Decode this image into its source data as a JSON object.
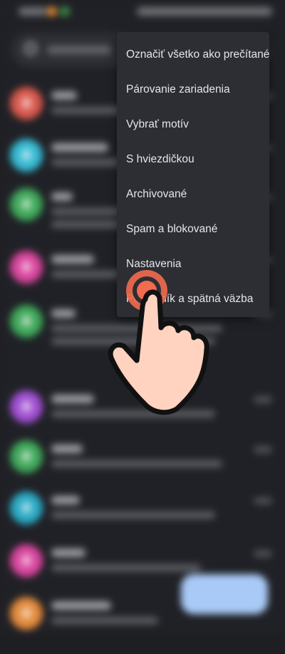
{
  "menu": {
    "items": [
      {
        "label": "Označiť všetko ako prečítané"
      },
      {
        "label": "Párovanie zariadenia"
      },
      {
        "label": "Vybrať motív"
      },
      {
        "label": "S hviezdičkou"
      },
      {
        "label": "Archivované"
      },
      {
        "label": "Spam a blokované"
      },
      {
        "label": "Nastavenia"
      },
      {
        "label": "Pomocník a spätná väzba"
      }
    ]
  },
  "colors": {
    "avatars": [
      "#d8584d",
      "#35b9d1",
      "#3fa85a",
      "#d8459d",
      "#3fa85a",
      "#9f4fd1",
      "#3fa85a",
      "#2aa9c4",
      "#d8459d",
      "#e28a3c"
    ],
    "menu_bg": "#2c2e33",
    "tap_ring": "#f26b4f",
    "hand_fill": "#ffd3bf"
  },
  "icons": {
    "search": "search-icon",
    "tap_gesture": "tap-hand-icon"
  }
}
